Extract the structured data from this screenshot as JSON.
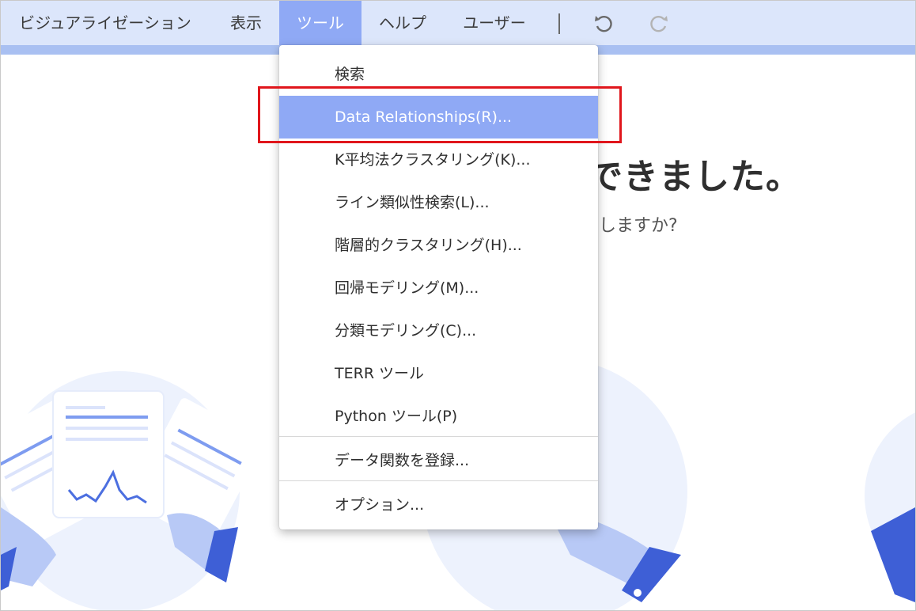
{
  "menubar": {
    "items": [
      {
        "label": "ビジュアライゼーション"
      },
      {
        "label": "表示"
      },
      {
        "label": "ツール",
        "active": true
      },
      {
        "label": "ヘルプ"
      },
      {
        "label": "ユーザー"
      }
    ],
    "icons": [
      "undo-icon",
      "redo-icon"
    ]
  },
  "hero": {
    "title": "できました。",
    "subtitle": "しますか?"
  },
  "tools_menu": {
    "items": [
      {
        "label": "検索"
      },
      {
        "label": "Data Relationships(R)...",
        "highlighted": true
      },
      {
        "label": "K平均法クラスタリング(K)..."
      },
      {
        "label": "ライン類似性検索(L)..."
      },
      {
        "label": "階層的クラスタリング(H)..."
      },
      {
        "label": "回帰モデリング(M)..."
      },
      {
        "label": "分類モデリング(C)..."
      },
      {
        "label": "TERR ツール"
      },
      {
        "label": "Python ツール(P)"
      },
      {
        "label": "データ関数を登録..."
      },
      {
        "label": "オプション..."
      }
    ]
  },
  "colors": {
    "menubar_bg": "#dce6fb",
    "accent": "#8fa9f5",
    "callout": "#e0161c"
  }
}
